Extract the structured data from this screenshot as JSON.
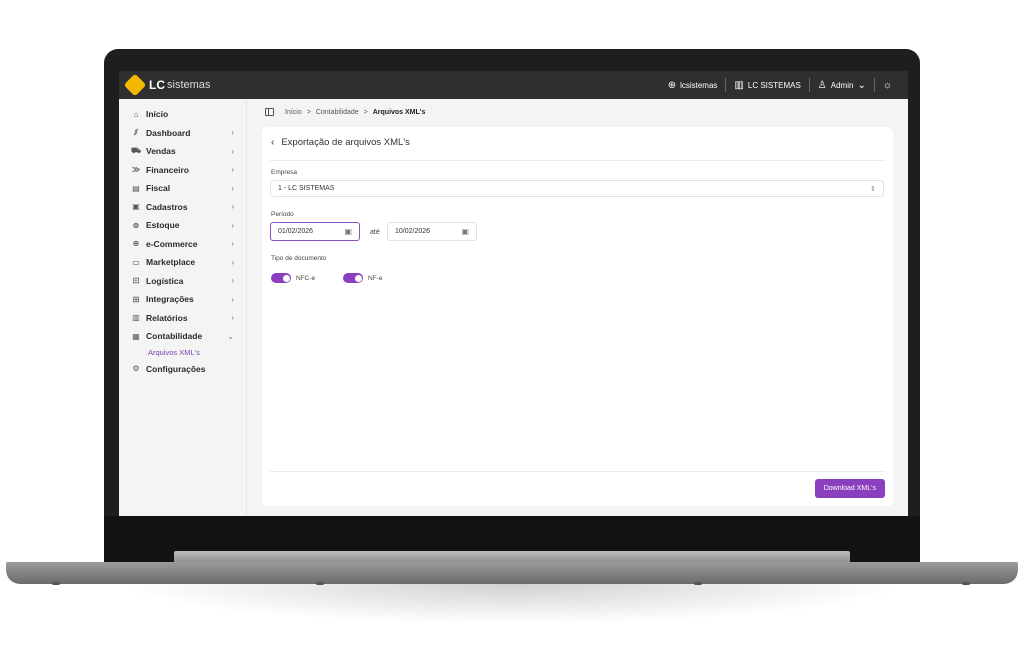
{
  "brand": {
    "name": "LC",
    "suffix": "sistemas"
  },
  "topbar": {
    "site": "lcsistemas",
    "company": "LC SISTEMAS",
    "user": "Admin"
  },
  "sidebar": {
    "items": [
      {
        "label": "Início",
        "icon": "home-icon",
        "glyph": "⌂",
        "chevron": ""
      },
      {
        "label": "Dashboard",
        "icon": "chart-icon",
        "glyph": "⫽",
        "chevron": "›"
      },
      {
        "label": "Vendas",
        "icon": "cart-icon",
        "glyph": "⛟",
        "chevron": "›"
      },
      {
        "label": "Financeiro",
        "icon": "money-icon",
        "glyph": "≫",
        "chevron": "›"
      },
      {
        "label": "Fiscal",
        "icon": "receipt-icon",
        "glyph": "▤",
        "chevron": "›"
      },
      {
        "label": "Cadastros",
        "icon": "id-card-icon",
        "glyph": "▣",
        "chevron": "›"
      },
      {
        "label": "Estoque",
        "icon": "box-icon",
        "glyph": "⊜",
        "chevron": "›"
      },
      {
        "label": "e-Commerce",
        "icon": "globe-icon",
        "glyph": "⊕",
        "chevron": "›"
      },
      {
        "label": "Marketplace",
        "icon": "store-icon",
        "glyph": "▭",
        "chevron": "›"
      },
      {
        "label": "Logística",
        "icon": "truck-icon",
        "glyph": "⊡",
        "chevron": "›"
      },
      {
        "label": "Integrações",
        "icon": "plug-icon",
        "glyph": "⊞",
        "chevron": "›"
      },
      {
        "label": "Relatórios",
        "icon": "report-icon",
        "glyph": "▥",
        "chevron": "›"
      },
      {
        "label": "Contabilidade",
        "icon": "calculator-icon",
        "glyph": "▦",
        "chevron": "⌄"
      }
    ],
    "subitem": "Arquivos XML's",
    "settings": {
      "label": "Configurações",
      "icon": "gear-icon",
      "glyph": "⚙"
    }
  },
  "breadcrumb": {
    "home": "Início",
    "section": "Contabilidade",
    "current": "Arquivos XML's",
    "separator": ">"
  },
  "form": {
    "title": "Exportação de arquivos XML's",
    "empresa_label": "Empresa",
    "empresa_value": "1 - LC SISTEMAS",
    "periodo_label": "Período",
    "date_start": "01/02/2026",
    "ate_label": "até",
    "date_end": "10/02/2026",
    "tipo_label": "Tipo de documento",
    "toggle_nfce": "NFC-e",
    "toggle_nfe": "NF-e",
    "toggle_nfce_on": true,
    "toggle_nfe_on": true,
    "download_label": "Download XML's"
  },
  "colors": {
    "accent": "#8a3fbf",
    "topbar": "#2f2f31",
    "brand_yellow": "#f5b800"
  }
}
